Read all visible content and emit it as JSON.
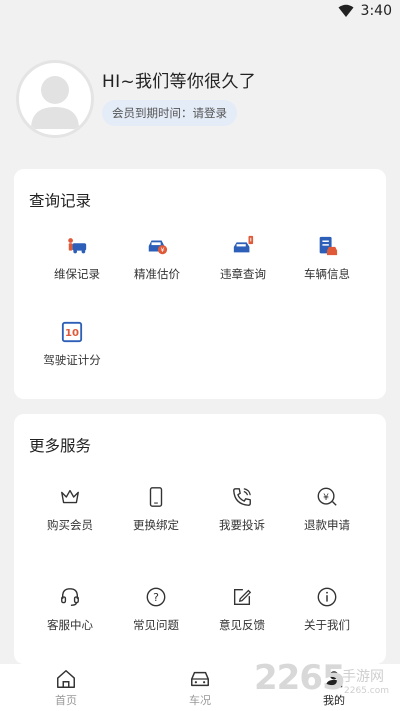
{
  "status_bar": {
    "time": "3:40",
    "icon": "wifi-icon"
  },
  "profile": {
    "greeting": "HI~我们等你很久了",
    "member_status": "会员到期时间：请登录"
  },
  "query_records": {
    "title": "查询记录",
    "items": [
      {
        "label": "维保记录",
        "icon": "car-repair-icon"
      },
      {
        "label": "精准估价",
        "icon": "car-price-icon"
      },
      {
        "label": "违章查询",
        "icon": "car-violation-icon"
      },
      {
        "label": "车辆信息",
        "icon": "vehicle-document-icon"
      },
      {
        "label": "驾驶证计分",
        "icon": "license-points-icon"
      }
    ]
  },
  "more_services": {
    "title": "更多服务",
    "items": [
      {
        "label": "购买会员",
        "icon": "crown-icon"
      },
      {
        "label": "更换绑定",
        "icon": "phone-icon"
      },
      {
        "label": "我要投诉",
        "icon": "call-icon"
      },
      {
        "label": "退款申请",
        "icon": "refund-icon"
      },
      {
        "label": "客服中心",
        "icon": "headset-icon"
      },
      {
        "label": "常见问题",
        "icon": "question-icon"
      },
      {
        "label": "意见反馈",
        "icon": "edit-icon"
      },
      {
        "label": "关于我们",
        "icon": "info-icon"
      }
    ]
  },
  "tab_bar": {
    "tabs": [
      {
        "label": "首页",
        "icon": "home-icon",
        "active": false
      },
      {
        "label": "车况",
        "icon": "car-icon",
        "active": false
      },
      {
        "label": "我的",
        "icon": "user-icon",
        "active": true
      }
    ]
  },
  "watermark": {
    "number": "2265",
    "text": "手游网",
    "url": "2265.com"
  },
  "colors": {
    "accent": "#2d5fb8",
    "accent_red": "#e05a3a",
    "background": "#f1f1f1",
    "badge_bg": "#e4ecf8"
  }
}
